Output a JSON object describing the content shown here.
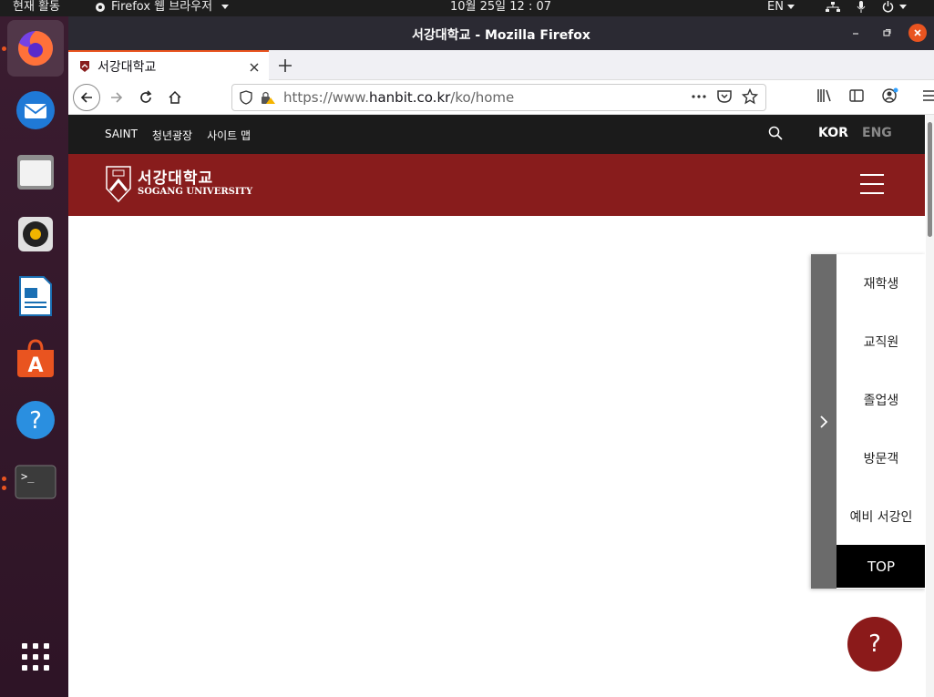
{
  "topbar": {
    "activities": "현재 활동",
    "app_menu": "Firefox 웹 브라우저",
    "clock": "10월 25일  12 : 07",
    "lang": "EN"
  },
  "dock": {
    "items": [
      "firefox-icon",
      "thunderbird-icon",
      "files-icon",
      "rhythmbox-icon",
      "writer-icon",
      "software-icon",
      "help-icon",
      "terminal-icon",
      "app-grid-icon"
    ]
  },
  "window": {
    "title": "서강대학교 - Mozilla Firefox"
  },
  "tab": {
    "title": "서강대학교"
  },
  "url": {
    "prefix": "https://www.",
    "domain": "hanbit.co.kr",
    "path": "/ko/home"
  },
  "site": {
    "util_links": [
      "SAINT",
      "청년광장",
      "사이트 맵"
    ],
    "lang_kor": "KOR",
    "lang_eng": "ENG",
    "logo_ko": "서강대학교",
    "logo_en": "SOGANG UNIVERSITY",
    "quick_menu": [
      "재학생",
      "교직원",
      "졸업생",
      "방문객",
      "예비 서강인"
    ],
    "top_label": "TOP",
    "help_label": "?"
  },
  "colors": {
    "brand": "#881c1c",
    "ubuntu_orange": "#e95420"
  }
}
